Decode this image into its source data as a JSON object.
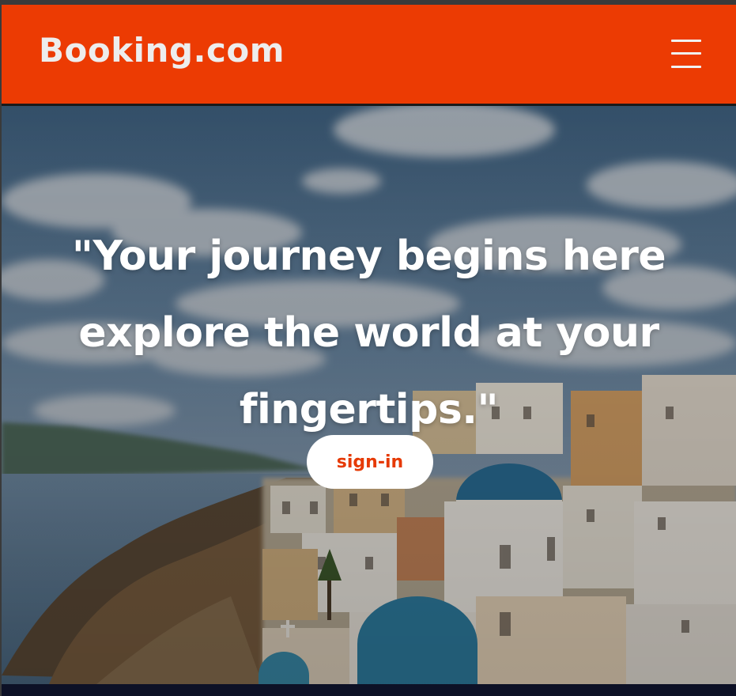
{
  "header": {
    "logo": "Booking.com",
    "menu_icon": "hamburger-menu-icon",
    "background_color": "#ec3b03"
  },
  "hero": {
    "headline": "\"Your journey begins here explore the world at your fingertips.\"",
    "background_image": "Santorini cliffside village with white buildings and blue domes over the sea",
    "signin_button": "sign-in",
    "button_text_color": "#e63a05"
  }
}
